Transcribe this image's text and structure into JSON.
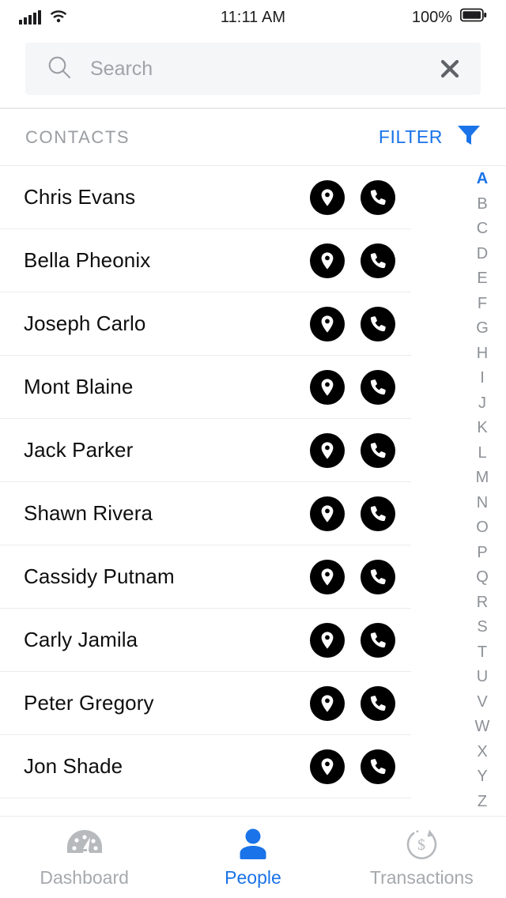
{
  "statusbar": {
    "signal_icon": "signal-bars-icon",
    "wifi_icon": "wifi-icon",
    "time": "11:11 AM",
    "battery_percent": "100%",
    "battery_icon": "battery-full-icon"
  },
  "search": {
    "icon": "search-icon",
    "placeholder": "Search",
    "value": "",
    "clear_icon": "close-icon"
  },
  "section": {
    "title": "CONTACTS",
    "filter_label": "FILTER",
    "filter_icon": "filter-funnel-icon"
  },
  "contacts": [
    {
      "name": "Chris Evans",
      "location_icon": "location-pin-icon",
      "call_icon": "phone-icon"
    },
    {
      "name": "Bella Pheonix",
      "location_icon": "location-pin-icon",
      "call_icon": "phone-icon"
    },
    {
      "name": "Joseph Carlo",
      "location_icon": "location-pin-icon",
      "call_icon": "phone-icon"
    },
    {
      "name": "Mont Blaine",
      "location_icon": "location-pin-icon",
      "call_icon": "phone-icon"
    },
    {
      "name": "Jack Parker",
      "location_icon": "location-pin-icon",
      "call_icon": "phone-icon"
    },
    {
      "name": "Shawn Rivera",
      "location_icon": "location-pin-icon",
      "call_icon": "phone-icon"
    },
    {
      "name": "Cassidy Putnam",
      "location_icon": "location-pin-icon",
      "call_icon": "phone-icon"
    },
    {
      "name": "Carly Jamila",
      "location_icon": "location-pin-icon",
      "call_icon": "phone-icon"
    },
    {
      "name": "Peter Gregory",
      "location_icon": "location-pin-icon",
      "call_icon": "phone-icon"
    },
    {
      "name": "Jon Shade",
      "location_icon": "location-pin-icon",
      "call_icon": "phone-icon"
    }
  ],
  "alpha_index": {
    "letters": [
      "A",
      "B",
      "C",
      "D",
      "E",
      "F",
      "G",
      "H",
      "I",
      "J",
      "K",
      "L",
      "M",
      "N",
      "O",
      "P",
      "Q",
      "R",
      "S",
      "T",
      "U",
      "V",
      "W",
      "X",
      "Y",
      "Z"
    ],
    "active": "A"
  },
  "tabbar": {
    "tabs": [
      {
        "label": "Dashboard",
        "icon": "gauge-icon",
        "active": false
      },
      {
        "label": "People",
        "icon": "person-icon",
        "active": true
      },
      {
        "label": "Transactions",
        "icon": "dollar-cycle-icon",
        "active": false
      }
    ]
  },
  "colors": {
    "accent": "#1a73e8",
    "action_button": "#000000",
    "muted_text": "#9a9da1",
    "search_background": "#f4f6f8"
  }
}
